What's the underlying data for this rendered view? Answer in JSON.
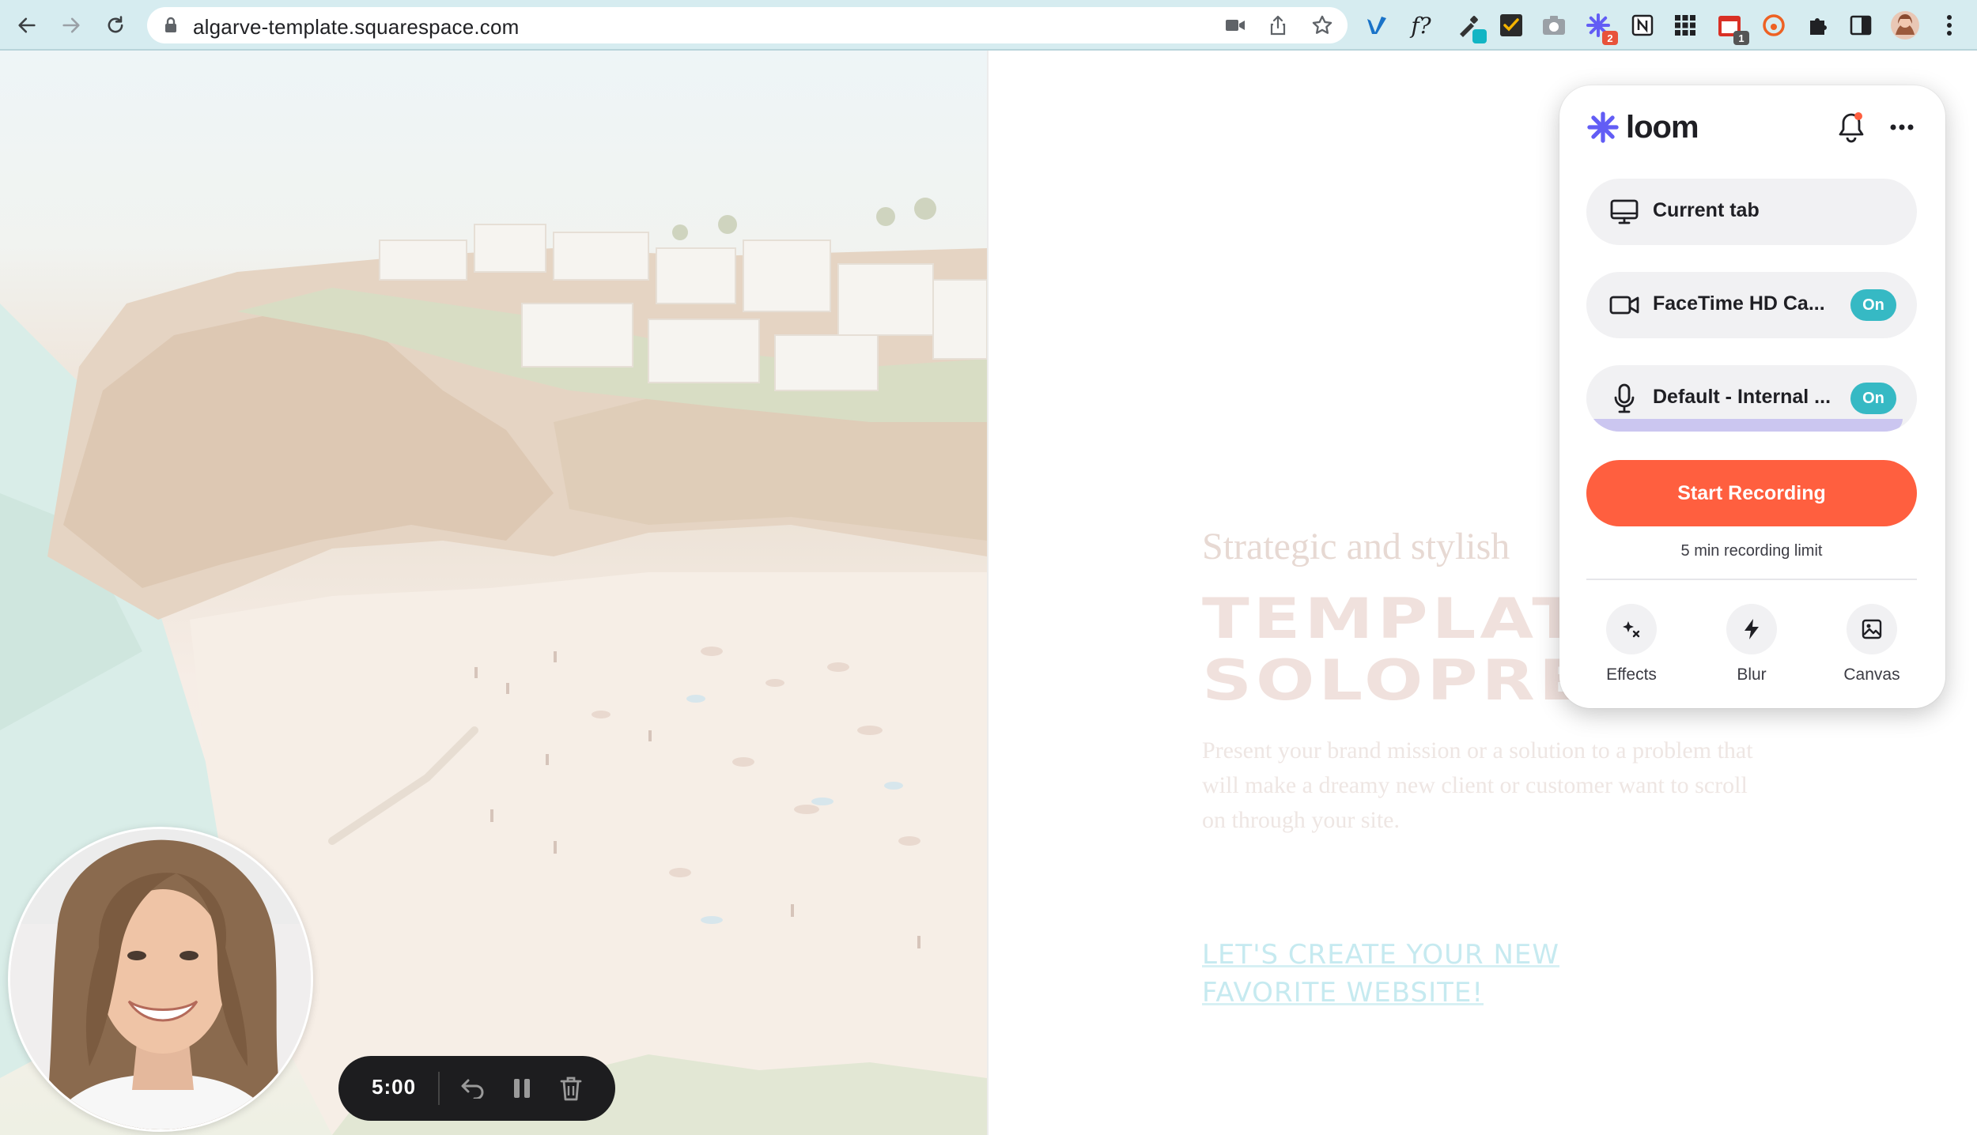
{
  "browser": {
    "url": "algarve-template.squarespace.com",
    "extensions": [
      {
        "name": "vimeo-extension",
        "badge": ""
      },
      {
        "name": "formula-extension",
        "badge": ""
      },
      {
        "name": "color-picker-extension",
        "badge": ""
      },
      {
        "name": "todo-extension",
        "badge": ""
      },
      {
        "name": "camera-extension",
        "badge": ""
      },
      {
        "name": "loom-extension",
        "badge": "2"
      },
      {
        "name": "notion-extension",
        "badge": ""
      },
      {
        "name": "apps-grid-extension",
        "badge": ""
      },
      {
        "name": "calendar-extension",
        "badge": "1"
      },
      {
        "name": "bitly-extension",
        "badge": ""
      }
    ],
    "badge_colors": {
      "loom": "#e8523a",
      "calendar": "#555555"
    }
  },
  "page": {
    "eyebrow": "Strategic and stylish",
    "headline": "TEMPLATE FOR SOLOPRENEURS",
    "body": "Present your brand mission or a solution to a problem that will make a dreamy new client or customer want to scroll on through your site.",
    "cta": "LET'S CREATE YOUR NEW FAVORITE WEBSITE!"
  },
  "recorder": {
    "time": "5:00"
  },
  "loom": {
    "brand": "loom",
    "source": "Current tab",
    "camera": {
      "label": "FaceTime HD Ca...",
      "state": "On"
    },
    "mic": {
      "label": "Default - Internal ...",
      "state": "On",
      "level": 0.97
    },
    "start_label": "Start Recording",
    "limit_text": "5 min recording limit",
    "tools": [
      {
        "label": "Effects",
        "icon": "sparkle-icon"
      },
      {
        "label": "Blur",
        "icon": "lightning-icon"
      },
      {
        "label": "Canvas",
        "icon": "image-icon"
      }
    ],
    "colors": {
      "accent": "#ff5f3f",
      "toggle": "#36b9c4",
      "brand": "#625df5"
    }
  }
}
